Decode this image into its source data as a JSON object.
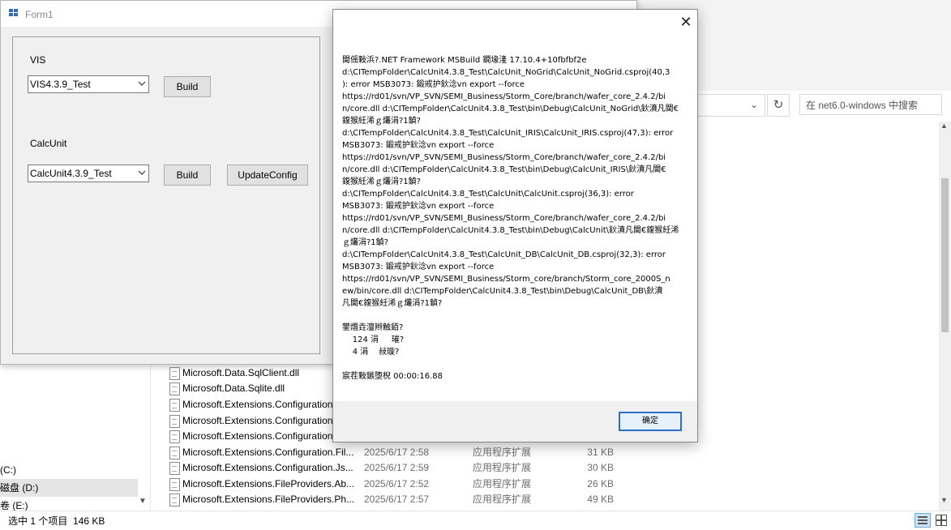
{
  "explorer": {
    "search_placeholder": "在 net6.0-windows 中搜索",
    "nav_items": [
      {
        "label": "(C:)"
      },
      {
        "label": "磁盘 (D:)"
      },
      {
        "label": "卷 (E:)"
      }
    ],
    "files": [
      {
        "name": "Microsoft.Data.SqlClient.dll",
        "date": "",
        "type": "",
        "size": ""
      },
      {
        "name": "Microsoft.Data.Sqlite.dll",
        "date": "",
        "type": "",
        "size": ""
      },
      {
        "name": "Microsoft.Extensions.Configuration",
        "date": "",
        "type": "",
        "size": ""
      },
      {
        "name": "Microsoft.Extensions.Configuration",
        "date": "",
        "type": "",
        "size": ""
      },
      {
        "name": "Microsoft.Extensions.Configuration",
        "date": "",
        "type": "",
        "size": ""
      },
      {
        "name": "Microsoft.Extensions.Configuration.Fil...",
        "date": "2025/6/17 2:58",
        "type": "应用程序扩展",
        "size": "31 KB"
      },
      {
        "name": "Microsoft.Extensions.Configuration.Js...",
        "date": "2025/6/17 2:59",
        "type": "应用程序扩展",
        "size": "30 KB"
      },
      {
        "name": "Microsoft.Extensions.FileProviders.Ab...",
        "date": "2025/6/17 2:52",
        "type": "应用程序扩展",
        "size": "26 KB"
      },
      {
        "name": "Microsoft.Extensions.FileProviders.Ph...",
        "date": "2025/6/17 2:57",
        "type": "应用程序扩展",
        "size": "49 KB"
      }
    ],
    "status_text": "选中 1 个项目  146 KB",
    "icons": {
      "refresh": "refresh-icon",
      "chevron": "chevron-down-icon"
    }
  },
  "form1": {
    "title": "Form1",
    "vis_label": "VIS",
    "vis_value": "VIS4.3.9_Test",
    "vis_build": "Build",
    "calc_label": "CalcUnit",
    "calc_value": "CalcUnit4.3.9_Test",
    "calc_build": "Build",
    "update_config": "UpdateConfig"
  },
  "msgbox": {
    "close": "✕",
    "lines": [
      "閫傜敤浜?.NET Framework MSBuild 鐗堟湰 17.10.4+10fbfbf2e",
      "d:\\CITempFolder\\CalcUnit4.3.8_Test\\CalcUnit_NoGrid\\CalcUnit_NoGrid.csproj(40,3",
      "): error MSB3073: 鍛戒护鈥淰vn export --force",
      "https://rd01/svn/VP_SVN/SEMI_Business/Storm_Core/branch/wafer_core_2.4.2/bi",
      "n/core.dll d:\\CITempFolder\\CalcUnit4.3.8_Test\\bin\\Debug\\CalcUnit_NoGrid\\鈥濆凡閫€",
      "鍑猴紝浠ｇ爜涓?1鍞?",
      "d:\\CITempFolder\\CalcUnit4.3.8_Test\\CalcUnit_IRIS\\CalcUnit_IRIS.csproj(47,3): error",
      "MSB3073: 鍛戒护鈥淰vn export --force",
      "https://rd01/svn/VP_SVN/SEMI_Business/Storm_Core/branch/wafer_core_2.4.2/bi",
      "n/core.dll d:\\CITempFolder\\CalcUnit4.3.8_Test\\bin\\Debug\\CalcUnit_IRIS\\鈥濆凡閫€",
      "鍑猴紝浠ｇ爜涓?1鍞?",
      "d:\\CITempFolder\\CalcUnit4.3.8_Test\\CalcUnit\\CalcUnit.csproj(36,3): error",
      "MSB3073: 鍛戒护鈥淰vn export --force",
      "https://rd01/svn/VP_SVN/SEMI_Business/Storm_Core/branch/wafer_core_2.4.2/bi",
      "n/core.dll d:\\CITempFolder\\CalcUnit4.3.8_Test\\bin\\Debug\\CalcUnit\\鈥濆凡閫€鍑猴紝浠",
      "ｇ爜涓?1鍞?",
      "d:\\CITempFolder\\CalcUnit4.3.8_Test\\CalcUnit_DB\\CalcUnit_DB.csproj(32,3): error",
      "MSB3073: 鍛戒护鈥淰vn export --force",
      "https://rd01/svn/VP_SVN/SEMI_Business/Storm_core/branch/Storm_core_2000S_n",
      "ew/bin/core.dll d:\\CITempFolder\\CalcUnit4.3.8_Test\\bin\\Debug\\CalcUnit_DB\\鈥濆",
      "凡閫€鍑猴紝浠ｇ爜涓?1鍞?",
      "",
      "鐢熸垚澶辫触銆?",
      "    124 涓     璀?",
      "    4 涓    敊璇?",
      "",
      "宸茬敤鏃堕棿 00:00:16.88"
    ],
    "ok_label": "确定"
  }
}
